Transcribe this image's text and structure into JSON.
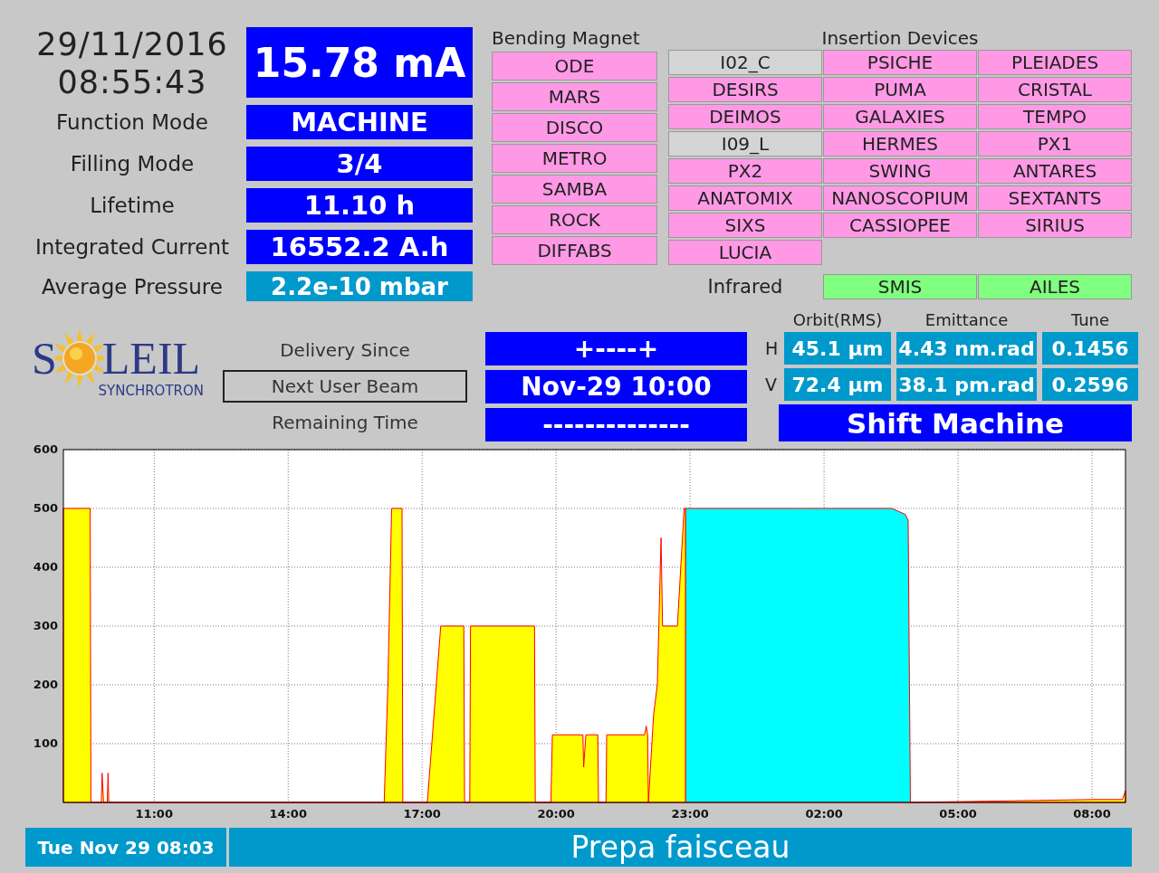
{
  "datetime": {
    "date": "29/11/2016",
    "time": "08:55:43"
  },
  "beam_current": "15.78 mA",
  "parameters": [
    {
      "label": "Function Mode",
      "value": "MACHINE",
      "kind": "primary"
    },
    {
      "label": "Filling Mode",
      "value": "3/4",
      "kind": "primary"
    },
    {
      "label": "Lifetime",
      "value": "11.10 h",
      "kind": "primary"
    },
    {
      "label": "Integrated Current",
      "value": "16552.2 A.h",
      "kind": "primary"
    },
    {
      "label": "Average Pressure",
      "value": "2.2e-10 mbar",
      "kind": "secondary"
    }
  ],
  "bending_magnet": {
    "title": "Bending Magnet",
    "items": [
      "ODE",
      "MARS",
      "DISCO",
      "METRO",
      "SAMBA",
      "ROCK",
      "DIFFABS"
    ]
  },
  "insertion_devices": {
    "title": "Insertion Devices",
    "items": [
      {
        "name": "I02_C",
        "color": "#d4d4d4"
      },
      {
        "name": "PSICHE",
        "color": "#ff99e6"
      },
      {
        "name": "PLEIADES",
        "color": "#ff99e6"
      },
      {
        "name": "DESIRS",
        "color": "#ff99e6"
      },
      {
        "name": "PUMA",
        "color": "#ff99e6"
      },
      {
        "name": "CRISTAL",
        "color": "#ff99e6"
      },
      {
        "name": "DEIMOS",
        "color": "#ff99e6"
      },
      {
        "name": "GALAXIES",
        "color": "#ff99e6"
      },
      {
        "name": "TEMPO",
        "color": "#ff99e6"
      },
      {
        "name": "I09_L",
        "color": "#d4d4d4"
      },
      {
        "name": "HERMES",
        "color": "#ff99e6"
      },
      {
        "name": "PX1",
        "color": "#ff99e6"
      },
      {
        "name": "PX2",
        "color": "#ff99e6"
      },
      {
        "name": "SWING",
        "color": "#ff99e6"
      },
      {
        "name": "ANTARES",
        "color": "#ff99e6"
      },
      {
        "name": "ANATOMIX",
        "color": "#ff99e6"
      },
      {
        "name": "NANOSCOPIUM",
        "color": "#ff99e6"
      },
      {
        "name": "SEXTANTS",
        "color": "#ff99e6"
      },
      {
        "name": "SIXS",
        "color": "#ff99e6"
      },
      {
        "name": "CASSIOPEE",
        "color": "#ff99e6"
      },
      {
        "name": "SIRIUS",
        "color": "#ff99e6"
      },
      {
        "name": "LUCIA",
        "color": "#ff99e6"
      }
    ]
  },
  "infrared": {
    "label": "Infrared",
    "items": [
      "SMIS",
      "AILES"
    ]
  },
  "logo": {
    "name_parts": [
      "S",
      "LEIL"
    ],
    "subtitle": "SYNCHROTRON"
  },
  "delivery": {
    "labels": [
      {
        "text": "Delivery Since",
        "selected": false
      },
      {
        "text": "Next User Beam",
        "selected": true
      },
      {
        "text": "Remaining Time",
        "selected": false
      }
    ],
    "values": [
      "+----+",
      "Nov-29 10:00",
      "--------------"
    ]
  },
  "beam_quality": {
    "columns": [
      "Orbit(RMS)",
      "Emittance",
      "Tune"
    ],
    "rows": [
      {
        "label": "H",
        "values": [
          "45.1 µm",
          "4.43 nm.rad",
          "0.1456"
        ]
      },
      {
        "label": "V",
        "values": [
          "72.4 µm",
          "38.1 pm.rad",
          "0.2596"
        ]
      }
    ],
    "shift": "Shift Machine"
  },
  "chart_data": {
    "type": "area",
    "x": [
      "2016-11-28T08:58",
      "2016-11-28T09:34",
      "2016-11-28T09:35",
      "2016-11-28T09:49",
      "2016-11-28T09:50",
      "2016-11-28T09:52",
      "2016-11-28T09:57",
      "2016-11-28T09:58",
      "2016-11-28T09:59",
      "2016-11-28T16:09",
      "2016-11-28T16:14",
      "2016-11-28T16:19",
      "2016-11-28T16:33",
      "2016-11-28T16:34",
      "2016-11-28T17:07",
      "2016-11-28T17:25",
      "2016-11-28T17:56",
      "2016-11-28T17:57",
      "2016-11-28T18:04",
      "2016-11-28T18:05",
      "2016-11-28T19:31",
      "2016-11-28T19:32",
      "2016-11-28T19:53",
      "2016-11-28T19:55",
      "2016-11-28T20:36",
      "2016-11-28T20:37",
      "2016-11-28T20:40",
      "2016-11-28T20:56",
      "2016-11-28T20:57",
      "2016-11-28T21:07",
      "2016-11-28T21:08",
      "2016-11-28T21:59",
      "2016-11-28T22:01",
      "2016-11-28T22:03",
      "2016-11-28T22:04",
      "2016-11-28T22:11",
      "2016-11-28T22:16",
      "2016-11-28T22:19",
      "2016-11-28T22:21",
      "2016-11-28T22:23",
      "2016-11-28T22:43",
      "2016-11-28T22:52",
      "2016-11-28T22:54",
      "2016-11-29T03:31",
      "2016-11-29T03:49",
      "2016-11-29T03:53",
      "2016-11-29T03:56",
      "2016-11-29T08:05",
      "2016-11-29T08:41",
      "2016-11-29T08:45"
    ],
    "series": [
      {
        "color": "#ffff00",
        "values": [
          500,
          500,
          0,
          0,
          50,
          0,
          0,
          50,
          0,
          0,
          200,
          500,
          500,
          0,
          0,
          300,
          300,
          0,
          0,
          300,
          300,
          0,
          0,
          115,
          115,
          60,
          115,
          115,
          0,
          0,
          115,
          115,
          130,
          115,
          0,
          150,
          200,
          350,
          450,
          300,
          300,
          500,
          500,
          null,
          null,
          null,
          0,
          5,
          5,
          20
        ]
      },
      {
        "color": "#00ffff",
        "values": [
          null,
          null,
          null,
          null,
          null,
          null,
          null,
          null,
          null,
          null,
          null,
          null,
          null,
          null,
          null,
          null,
          null,
          null,
          null,
          null,
          null,
          null,
          null,
          null,
          null,
          null,
          null,
          null,
          null,
          null,
          null,
          null,
          null,
          null,
          null,
          null,
          null,
          null,
          null,
          null,
          null,
          null,
          500,
          500,
          490,
          480,
          0,
          null,
          null,
          null
        ]
      }
    ],
    "xlim": [
      "2016-11-28T08:58",
      "2016-11-29T08:45"
    ],
    "ylim": [
      0,
      600
    ],
    "grid": true,
    "xticks": [
      {
        "value": "2016-11-28T11:00",
        "label": "11:00"
      },
      {
        "value": "2016-11-28T14:00",
        "label": "14:00"
      },
      {
        "value": "2016-11-28T17:00",
        "label": "17:00"
      },
      {
        "value": "2016-11-28T20:00",
        "label": "20:00"
      },
      {
        "value": "2016-11-28T23:00",
        "label": "23:00"
      },
      {
        "value": "2016-11-29T02:00",
        "label": "02:00"
      },
      {
        "value": "2016-11-29T05:00",
        "label": "05:00"
      },
      {
        "value": "2016-11-29T08:00",
        "label": "08:00"
      }
    ],
    "yticks": [
      100,
      200,
      300,
      400,
      500,
      600
    ]
  },
  "status_bar": {
    "date": "Tue Nov 29 08:03",
    "message": "Prepa faisceau"
  }
}
